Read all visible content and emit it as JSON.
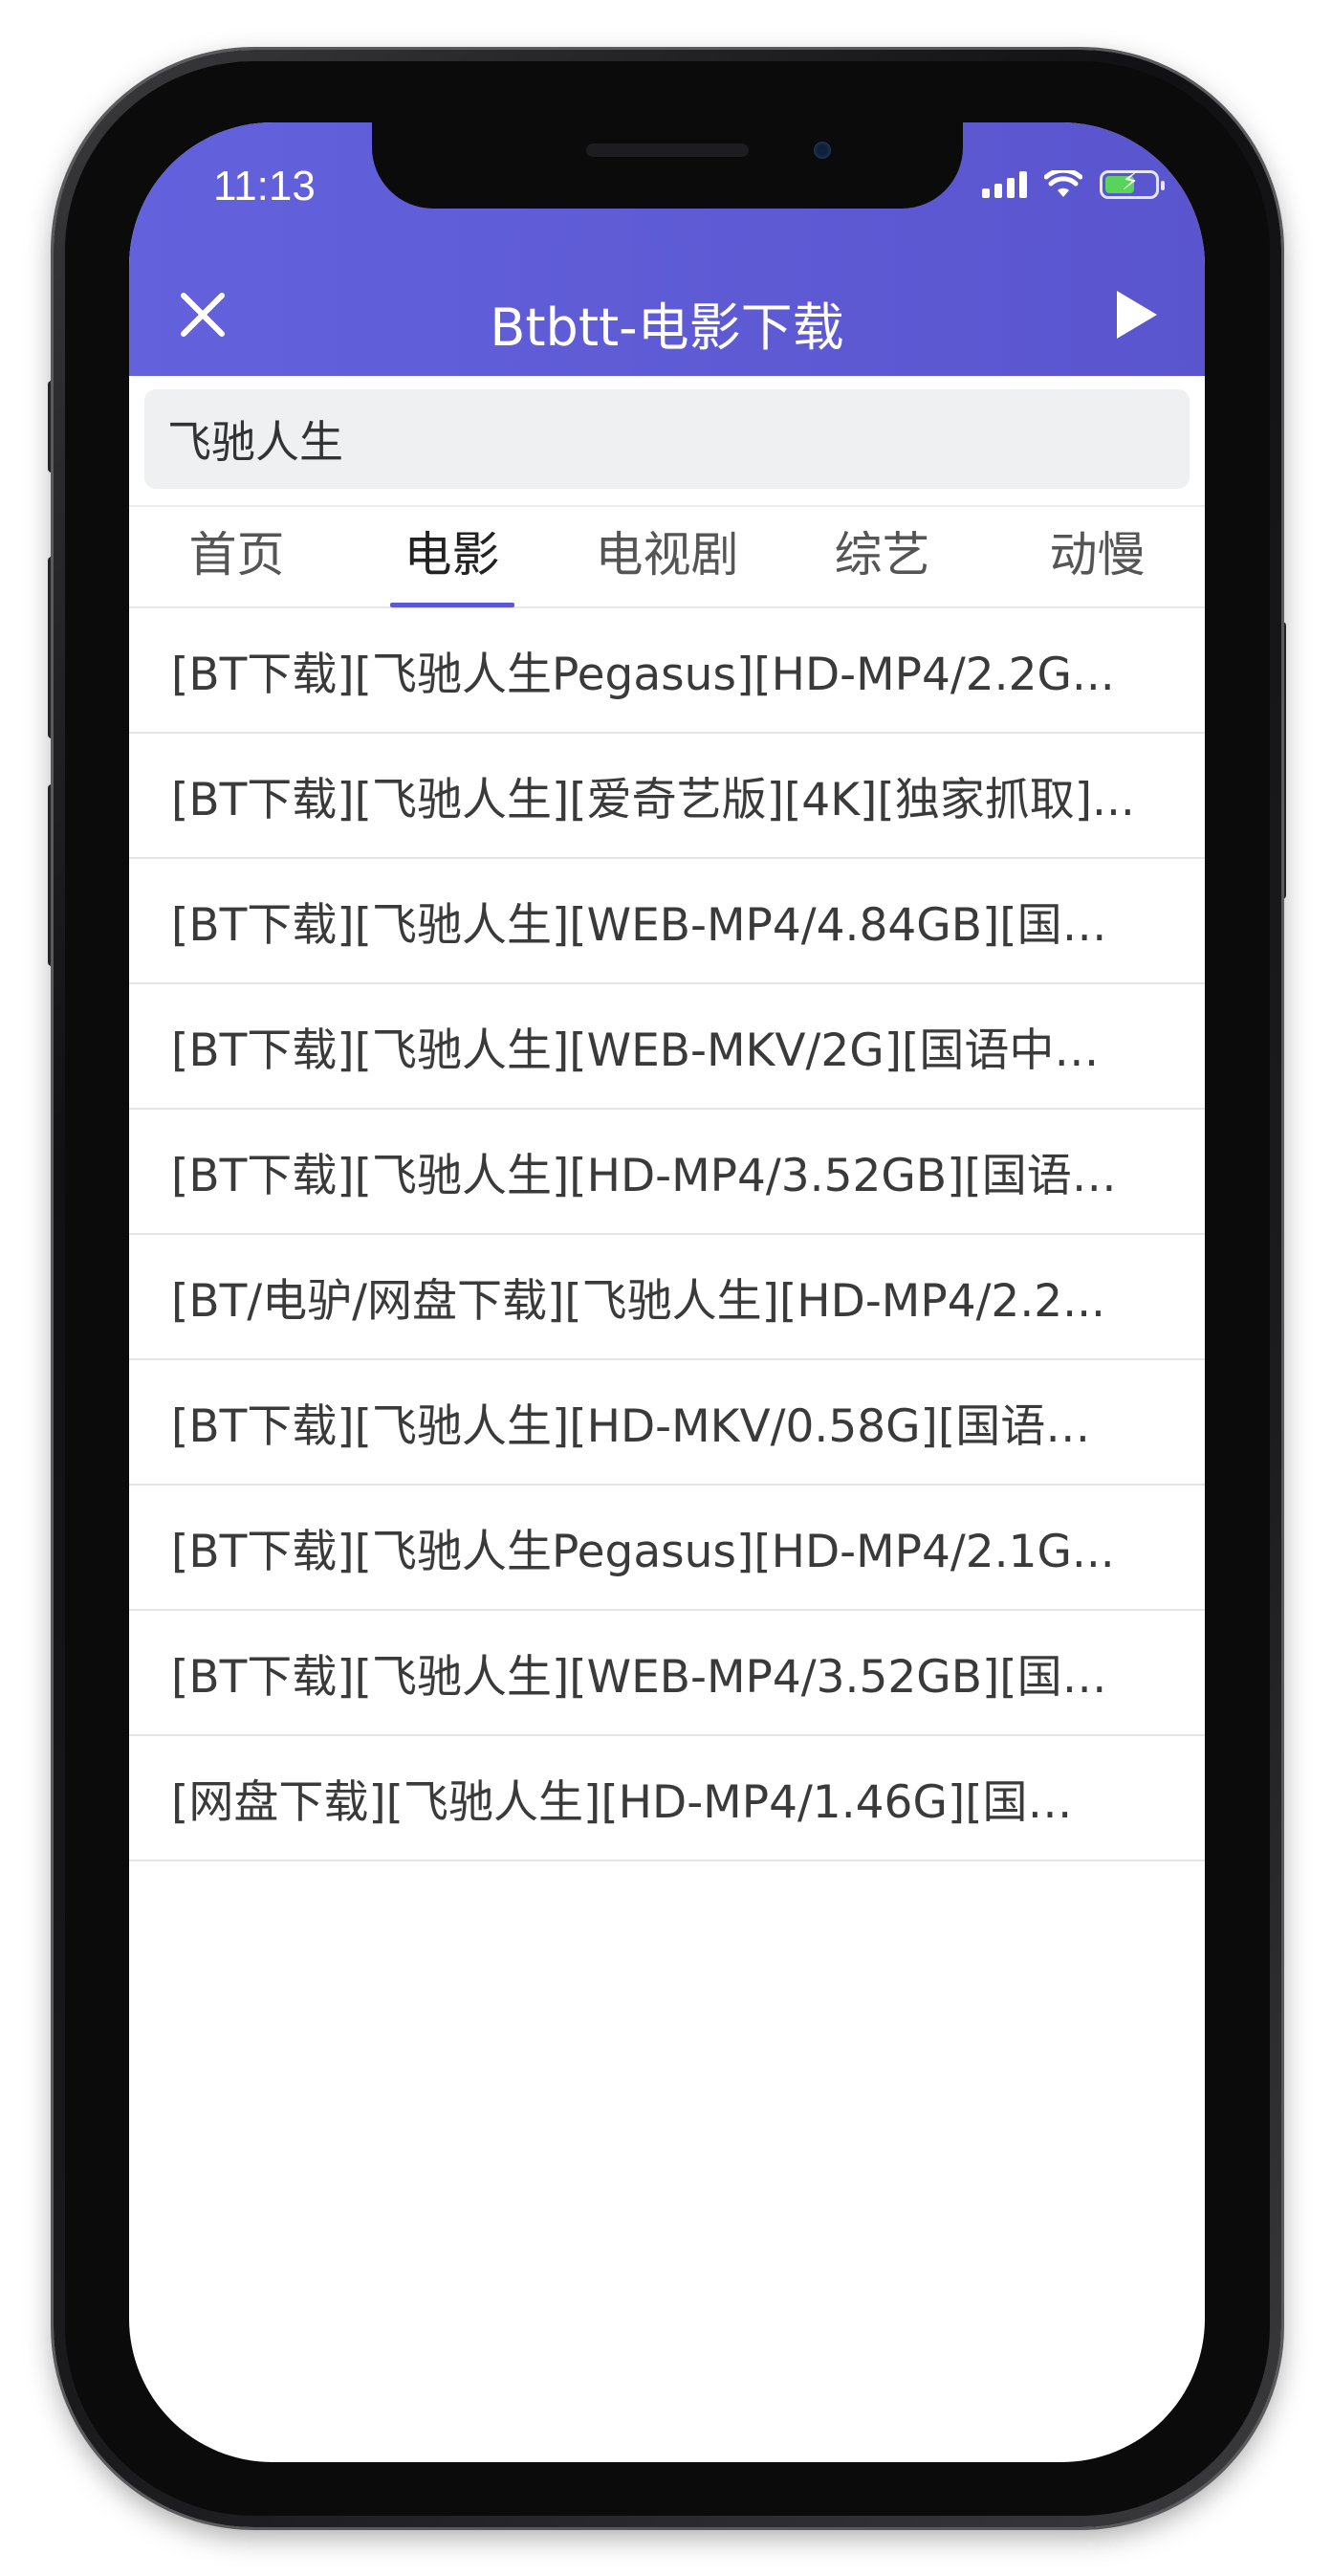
{
  "status_bar": {
    "time": "11:13"
  },
  "header": {
    "title": "Btbtt-电影下载",
    "colors": {
      "start": "#6361dc",
      "end": "#5a55cf"
    }
  },
  "search": {
    "value": "飞驰人生"
  },
  "tabs": [
    {
      "label": "首页",
      "active": false
    },
    {
      "label": "电影",
      "active": true
    },
    {
      "label": "电视剧",
      "active": false
    },
    {
      "label": "综艺",
      "active": false
    },
    {
      "label": "动慢",
      "active": false
    }
  ],
  "results": [
    "[BT下载][飞驰人生Pegasus][HD-MP4/2.2G...",
    "[BT下载][飞驰人生][爱奇艺版][4K][独家抓取]...",
    "[BT下载][飞驰人生][WEB-MP4/4.84GB][国…",
    "[BT下载][飞驰人生][WEB-MKV/2G][国语中…",
    "[BT下载][飞驰人生][HD-MP4/3.52GB][国语…",
    "[BT/电驴/网盘下载][飞驰人生][HD-MP4/2.2...",
    "[BT下载][飞驰人生][HD-MKV/0.58G][国语…",
    "[BT下载][飞驰人生Pegasus][HD-MP4/2.1G...",
    "[BT下载][飞驰人生][WEB-MP4/3.52GB][国…",
    "[网盘下载][飞驰人生][HD-MP4/1.46G][国…"
  ],
  "icons": {
    "close": "close-icon",
    "play": "play-icon",
    "signal": "signal-icon",
    "wifi": "wifi-icon",
    "battery": "battery-icon"
  }
}
